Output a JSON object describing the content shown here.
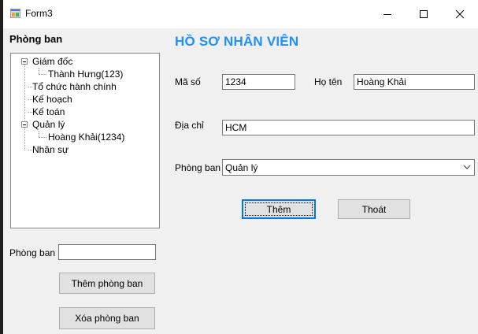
{
  "window": {
    "title": "Form3"
  },
  "left": {
    "section_title": "Phòng ban",
    "tree": [
      {
        "label": "Giám đốc"
      },
      {
        "label": "Thành Hưng(123)"
      },
      {
        "label": "Tổ chức hành chính"
      },
      {
        "label": "Kế hoạch"
      },
      {
        "label": "Kế toán"
      },
      {
        "label": "Quản lý"
      },
      {
        "label": "Hoàng Khải(1234)"
      },
      {
        "label": "Nhân sự"
      }
    ],
    "dept_label": "Phòng ban",
    "dept_input_value": "",
    "add_button": "Thêm phòng ban",
    "delete_button": "Xóa phòng ban"
  },
  "form": {
    "heading": "HỒ SƠ NHÂN VIÊN",
    "id_label": "Mã số",
    "id_value": "1234",
    "name_label": "Họ tên",
    "name_value": "Hoàng Khải",
    "address_label": "Địa chỉ",
    "address_value": "HCM",
    "dept_label": "Phòng ban",
    "dept_value": "Quản lý",
    "add_button": "Thêm",
    "exit_button": "Thoát"
  },
  "colors": {
    "heading": "#1e90ff",
    "focus_border": "#0078d7"
  }
}
